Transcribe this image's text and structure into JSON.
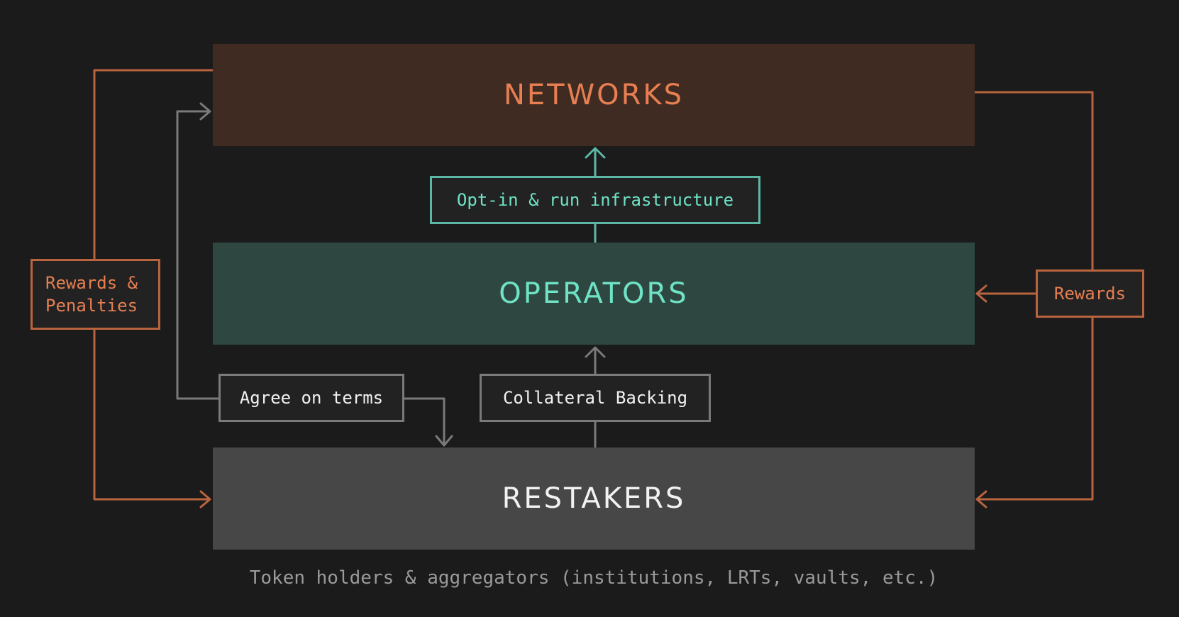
{
  "layers": {
    "networks": "NETWORKS",
    "operators": "OPERATORS",
    "restakers": "RESTAKERS"
  },
  "labels": {
    "opt_in": "Opt-in & run infrastructure",
    "agree_terms": "Agree on terms",
    "collateral": "Collateral Backing",
    "rewards_penalties_line1": "Rewards &",
    "rewards_penalties_line2": "Penalties",
    "rewards": "Rewards"
  },
  "caption": "Token holders & aggregators (institutions, LRTs, vaults, etc.)",
  "colors": {
    "background": "#1b1b1b",
    "networks_fill": "#3f2b21",
    "networks_text": "#e77f52",
    "operators_fill": "#2e4841",
    "operators_text": "#6fe3c6",
    "restakers_fill": "#474747",
    "restakers_text": "#f2f2f2",
    "orange_line": "#b9643f",
    "teal_line": "#5cb8a4",
    "gray_line": "#7a7a7a"
  }
}
